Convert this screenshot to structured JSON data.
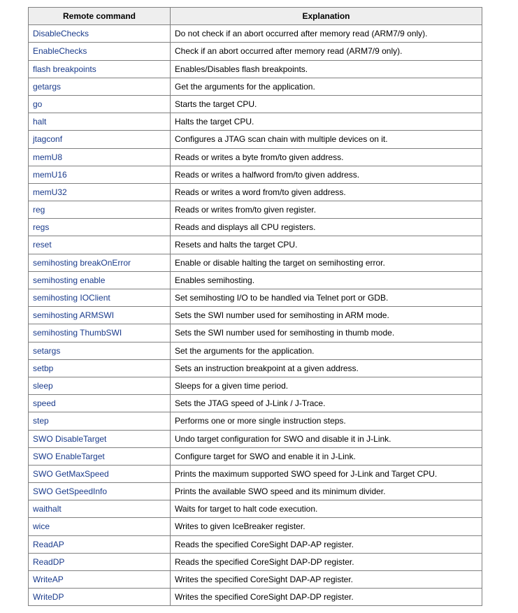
{
  "headers": {
    "command": "Remote command",
    "explanation": "Explanation"
  },
  "rows": [
    {
      "cmd": "DisableChecks",
      "desc": "Do not check if an abort occurred after memory read (ARM7/9 only)."
    },
    {
      "cmd": "EnableChecks",
      "desc": "Check if an abort occurred after memory read (ARM7/9 only)."
    },
    {
      "cmd": "flash breakpoints",
      "desc": "Enables/Disables flash breakpoints."
    },
    {
      "cmd": "getargs",
      "desc": "Get the arguments for the application."
    },
    {
      "cmd": "go",
      "desc": "Starts the target CPU."
    },
    {
      "cmd": "halt",
      "desc": "Halts the target CPU."
    },
    {
      "cmd": "jtagconf",
      "desc": "Configures a JTAG scan chain with multiple devices on it."
    },
    {
      "cmd": "memU8",
      "desc": "Reads or writes a byte from/to given address."
    },
    {
      "cmd": "memU16",
      "desc": "Reads or writes a halfword from/to given address."
    },
    {
      "cmd": "memU32",
      "desc": "Reads or writes a word from/to given address."
    },
    {
      "cmd": "reg",
      "desc": "Reads or writes from/to given register."
    },
    {
      "cmd": "regs",
      "desc": "Reads and displays all CPU registers."
    },
    {
      "cmd": "reset",
      "desc": "Resets and halts the target CPU."
    },
    {
      "cmd": "semihosting breakOnError",
      "desc": "Enable or disable halting the target on semihosting error."
    },
    {
      "cmd": "semihosting enable",
      "desc": "Enables semihosting."
    },
    {
      "cmd": "semihosting IOClient",
      "desc": "Set semihosting I/O to be handled via Telnet port or GDB."
    },
    {
      "cmd": "semihosting ARMSWI",
      "desc": "Sets the SWI number used for semihosting in ARM mode."
    },
    {
      "cmd": "semihosting ThumbSWI",
      "desc": "Sets the SWI number used for semihosting in thumb mode."
    },
    {
      "cmd": "setargs",
      "desc": "Set the arguments for the application."
    },
    {
      "cmd": "setbp",
      "desc": "Sets an instruction breakpoint at a given address."
    },
    {
      "cmd": "sleep",
      "desc": "Sleeps for a given time period."
    },
    {
      "cmd": "speed",
      "desc": "Sets the JTAG speed of J-Link / J-Trace."
    },
    {
      "cmd": "step",
      "desc": "Performs one or more single instruction steps."
    },
    {
      "cmd": "SWO DisableTarget",
      "desc": "Undo target configuration for SWO and disable it in J-Link."
    },
    {
      "cmd": "SWO EnableTarget",
      "desc": "Configure target for SWO and enable it in J-Link."
    },
    {
      "cmd": "SWO GetMaxSpeed",
      "desc": "Prints the maximum supported SWO speed for J-Link and Target CPU."
    },
    {
      "cmd": "SWO GetSpeedInfo",
      "desc": "Prints the available SWO speed and its minimum divider."
    },
    {
      "cmd": "waithalt",
      "desc": "Waits for target to halt code execution."
    },
    {
      "cmd": "wice",
      "desc": "Writes to given IceBreaker register."
    },
    {
      "cmd": "ReadAP",
      "desc": "Reads the specified CoreSight DAP-AP register."
    },
    {
      "cmd": "ReadDP",
      "desc": "Reads the specified CoreSight DAP-DP register."
    },
    {
      "cmd": "WriteAP",
      "desc": "Writes the specified CoreSight DAP-AP register."
    },
    {
      "cmd": "WriteDP",
      "desc": "Writes the specified CoreSight DAP-DP register."
    }
  ]
}
